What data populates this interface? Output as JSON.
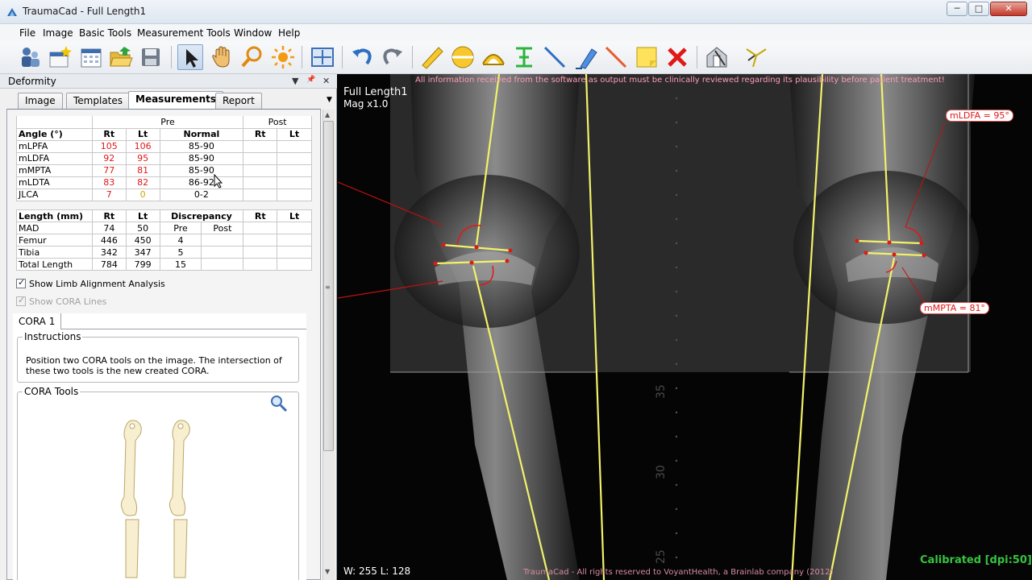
{
  "window": {
    "title": "TraumaCad - Full Length1",
    "minimize_label": "─",
    "maximize_label": "□",
    "close_label": "✕"
  },
  "menu": {
    "items": [
      {
        "label": "File"
      },
      {
        "label": "Image"
      },
      {
        "label": "Basic Tools"
      },
      {
        "label": "Measurement Tools"
      },
      {
        "label": "Window"
      },
      {
        "label": "Help"
      }
    ]
  },
  "toolbar": {
    "icons": [
      "patients-icon",
      "new-image-icon",
      "calendar-grid-icon",
      "open-folder-icon",
      "save-disk-icon",
      "select-arrow-icon",
      "pan-hand-icon",
      "zoom-magnifier-icon",
      "brightness-sun-icon",
      "fit-screen-icon",
      "undo-icon",
      "redo-icon",
      "ruler-icon",
      "circle-tool-icon",
      "angle-tool-icon",
      "h-tool-icon",
      "line-tool-icon",
      "eraser-icon",
      "pointer-line-icon",
      "note-icon",
      "delete-x-icon",
      "calibration-icon",
      "alignment-icon"
    ]
  },
  "panel": {
    "title": "Deformity",
    "dropdown_icon": "▼",
    "pin_icon": "📌",
    "close_icon": "✕",
    "tabs": [
      {
        "label": "Image",
        "active": false
      },
      {
        "label": "Templates",
        "active": false
      },
      {
        "label": "Measurements",
        "active": true
      },
      {
        "label": "Report",
        "active": false
      }
    ],
    "tab_menu_icon": "▼",
    "angle_table": {
      "group_pre": "Pre",
      "group_post": "Post",
      "headers": [
        "Angle (°)",
        "Rt",
        "Lt",
        "Normal",
        "Rt",
        "Lt"
      ],
      "rows": [
        {
          "name": "mLPFA",
          "rt": "105",
          "lt": "106",
          "normal": "85-90",
          "rt_color": "red",
          "lt_color": "red"
        },
        {
          "name": "mLDFA",
          "rt": "92",
          "lt": "95",
          "normal": "85-90",
          "rt_color": "red",
          "lt_color": "red"
        },
        {
          "name": "mMPTA",
          "rt": "77",
          "lt": "81",
          "normal": "85-90",
          "rt_color": "red",
          "lt_color": "red"
        },
        {
          "name": "mLDTA",
          "rt": "83",
          "lt": "82",
          "normal": "86-92",
          "rt_color": "red",
          "lt_color": "red"
        },
        {
          "name": "JLCA",
          "rt": "7",
          "lt": "0",
          "normal": "0-2",
          "rt_color": "red",
          "lt_color": "yellow"
        }
      ]
    },
    "length_table": {
      "headers": [
        "Length (mm)",
        "Rt",
        "Lt",
        "Discrepancy",
        "Rt",
        "Lt"
      ],
      "sub_pre": "Pre",
      "sub_post": "Post",
      "rows": [
        {
          "name": "Femur",
          "rt": "446",
          "lt": "450",
          "pre": "4"
        },
        {
          "name": "Tibia",
          "rt": "342",
          "lt": "347",
          "pre": "5"
        },
        {
          "name": "Total Length",
          "rt": "784",
          "lt": "799",
          "pre": "15"
        }
      ],
      "mad": {
        "name": "MAD",
        "rt": "74",
        "lt": "50"
      }
    },
    "show_limb_alignment": {
      "label": "Show Limb Alignment Analysis",
      "checked": true
    },
    "show_cora_lines": {
      "label": "Show CORA Lines",
      "checked": true,
      "disabled": true
    },
    "cora_tab": "CORA 1",
    "instructions_title": "Instructions",
    "instructions_text": "Position two CORA tools on the image. The intersection of these two tools is the new created CORA.",
    "cora_tools_title": "CORA Tools"
  },
  "viewer": {
    "warning": "All information received from the software as output must be clinically reviewed regarding its plausibility before patient treatment!",
    "image_name": "Full Length1",
    "magnification": "Mag x1.0",
    "window_level": "W: 255 L: 128",
    "copyright": "TraumaCad -  All rights reserved to VoyantHealth, a Brainlab company  (2012)",
    "calibration": "Calibrated [dpi:50]",
    "label_mldfa": "mLDFA = 95°",
    "label_mmpta": "mMPTA = 81°",
    "ruler_marks": [
      "35",
      "30",
      "25"
    ]
  },
  "colors": {
    "overlay_yellow": "#f2f26a",
    "marker_red": "#e01818",
    "warning_pink": "#ff9cb8",
    "calibrated_green": "#36c440"
  }
}
